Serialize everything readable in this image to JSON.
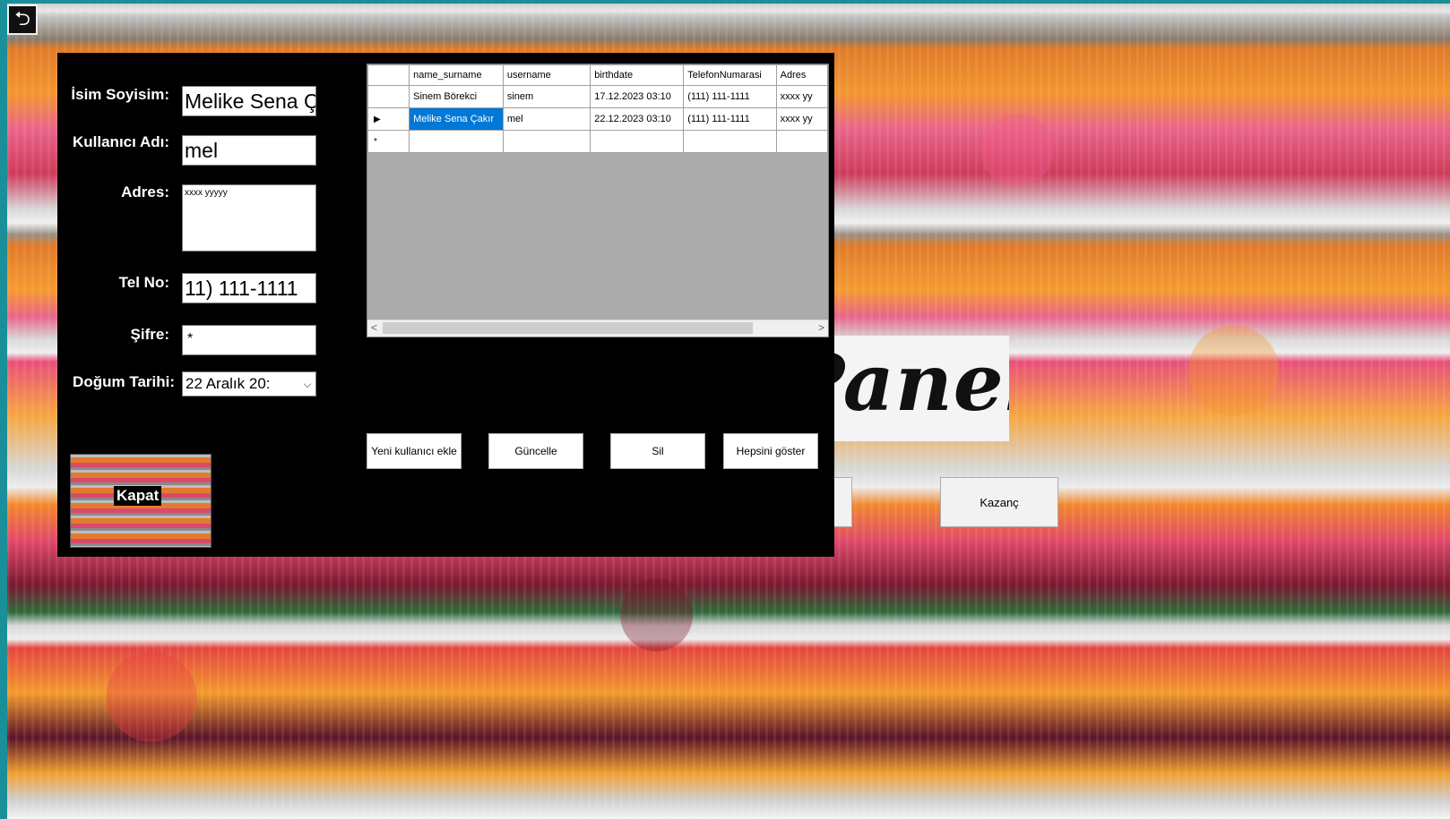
{
  "window": {
    "restore_icon": "restore-window-icon",
    "restore_glyph": "⮌"
  },
  "background_logo": {
    "text": "Panel"
  },
  "background_buttons": {
    "kazanc": "Kazanç"
  },
  "form": {
    "labels": {
      "name": "İsim Soyisim:",
      "username": "Kullanıcı Adı:",
      "address": "Adres:",
      "phone": "Tel No:",
      "password": "Şifre:",
      "birthdate": "Doğum Tarihi:"
    },
    "values": {
      "name": "Melike Sena Ç",
      "username": "mel",
      "address": "xxxx yyyyy",
      "phone": "11) 111-1111",
      "password": "*",
      "birthdate": "22   Aralık   20:"
    },
    "dropdown_glyph": "⌵",
    "close_button": "Kapat",
    "buttons": {
      "add": "Yeni kullanıcı ekle",
      "update": "Güncelle",
      "delete": "Sil",
      "show_all": "Hepsini göster"
    }
  },
  "grid": {
    "columns": [
      "name_surname",
      "username",
      "birthdate",
      "TelefonNumarasi",
      "Adres"
    ],
    "rows": [
      {
        "indicator": "",
        "cells": [
          "Sinem Börekci",
          "sinem",
          "17.12.2023 03:10",
          "(111) 111-1111",
          "xxxx yy"
        ]
      },
      {
        "indicator": "▶",
        "cells": [
          "Melike Sena Çakır",
          "mel",
          "22.12.2023 03:10",
          "(111) 111-1111",
          "xxxx yy"
        ]
      },
      {
        "indicator": "*",
        "cells": [
          "",
          "",
          "",
          "",
          ""
        ]
      }
    ],
    "scroll_left": "<",
    "scroll_right": ">"
  }
}
